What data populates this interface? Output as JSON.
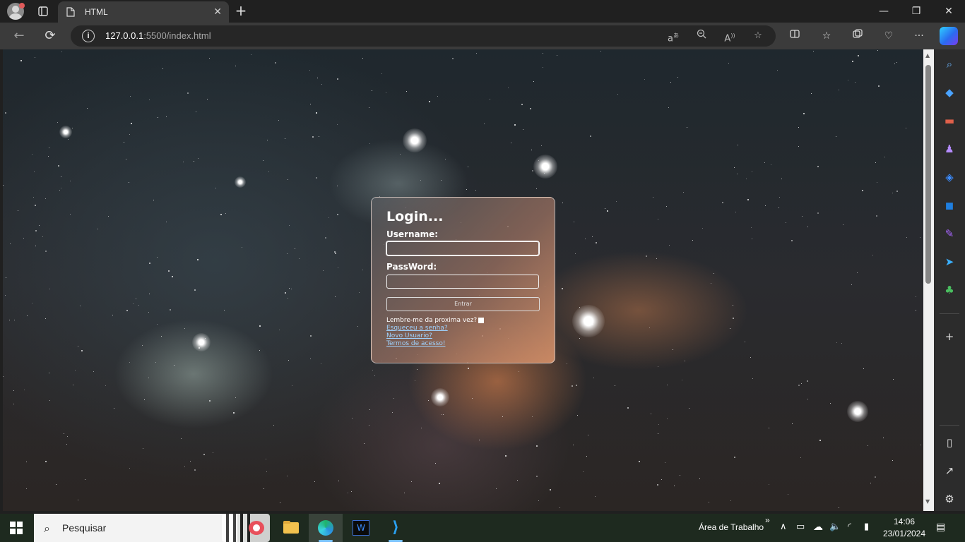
{
  "browser": {
    "tab_title": "HTML",
    "tab_close": "✕",
    "new_tab": "+",
    "window_controls": {
      "minimize": "—",
      "restore": "❐",
      "close": "✕"
    },
    "url_host": "127.0.0.1",
    "url_rest": ":5500/index.html",
    "nav": {
      "back": "←",
      "reload": "⟳"
    }
  },
  "login": {
    "title": "Login...",
    "username_label": "Username:",
    "username_value": "",
    "password_label": "PassWord:",
    "password_value": "",
    "submit_label": "Entrar",
    "remember_label": "Lembre-me da proxima vez?",
    "links": {
      "forgot": "Esqueceu a senha?",
      "new_user": "Novo Usuario?",
      "terms": "Termos de acesso!"
    }
  },
  "taskbar": {
    "search_placeholder": "Pesquisar",
    "desktop_label": "Área de Trabalho",
    "time": "14:06",
    "date": "23/01/2024"
  },
  "colors": {
    "browser_bg": "#202020",
    "toolbar_bg": "#3b3b3b",
    "link": "#9fd3ff",
    "taskbar_bg": "#1e2a1f"
  }
}
